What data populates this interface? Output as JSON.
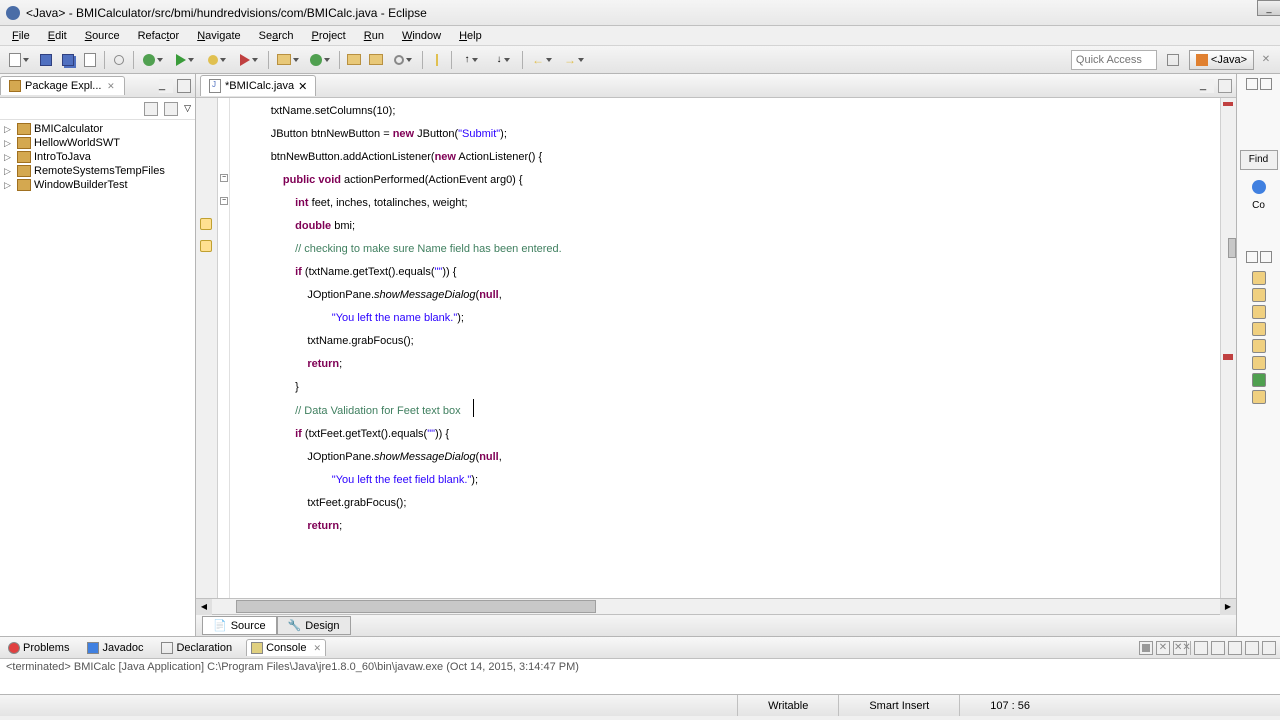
{
  "titlebar": {
    "title": "<Java> - BMICalculator/src/bmi/hundredvisions/com/BMICalc.java - Eclipse"
  },
  "menubar": {
    "items": [
      "File",
      "Edit",
      "Source",
      "Refactor",
      "Navigate",
      "Search",
      "Project",
      "Run",
      "Window",
      "Help"
    ]
  },
  "toolbar": {
    "quick_access_placeholder": "Quick Access",
    "perspective": "<Java>"
  },
  "pkg_explorer": {
    "title": "Package Expl...",
    "projects": [
      "BMICalculator",
      "HellowWorldSWT",
      "IntroToJava",
      "RemoteSystemsTempFiles",
      "WindowBuilderTest"
    ]
  },
  "editor": {
    "tab_title": "*BMICalc.java",
    "source_tab": "Source",
    "design_tab": "Design",
    "code_lines": [
      {
        "indent": 3,
        "tokens": [
          {
            "t": "txtName.setColumns(10);"
          }
        ]
      },
      {
        "indent": 0,
        "tokens": [
          {
            "t": ""
          }
        ]
      },
      {
        "indent": 3,
        "tokens": [
          {
            "t": "JButton btnNewButton = "
          },
          {
            "t": "new",
            "c": "kw"
          },
          {
            "t": " JButton("
          },
          {
            "t": "\"Submit\"",
            "c": "str"
          },
          {
            "t": ");"
          }
        ]
      },
      {
        "indent": 3,
        "tokens": [
          {
            "t": "btnNewButton.addActionListener("
          },
          {
            "t": "new",
            "c": "kw"
          },
          {
            "t": " ActionListener() {"
          }
        ]
      },
      {
        "indent": 4,
        "tokens": [
          {
            "t": "public",
            "c": "kw"
          },
          {
            "t": " "
          },
          {
            "t": "void",
            "c": "kw"
          },
          {
            "t": " actionPerformed(ActionEvent arg0) {"
          }
        ]
      },
      {
        "indent": 5,
        "tokens": [
          {
            "t": "int",
            "c": "kw"
          },
          {
            "t": " feet, inches, totalinches, weight;"
          }
        ]
      },
      {
        "indent": 5,
        "tokens": [
          {
            "t": "double",
            "c": "kw"
          },
          {
            "t": " bmi;"
          }
        ]
      },
      {
        "indent": 5,
        "tokens": [
          {
            "t": "// checking to make sure Name field has been entered.",
            "c": "cmt"
          }
        ]
      },
      {
        "indent": 5,
        "tokens": [
          {
            "t": "if",
            "c": "kw"
          },
          {
            "t": " (txtName.getText().equals("
          },
          {
            "t": "\"\"",
            "c": "str"
          },
          {
            "t": ")) {"
          }
        ]
      },
      {
        "indent": 6,
        "tokens": [
          {
            "t": "JOptionPane."
          },
          {
            "t": "showMessageDialog",
            "c": "mth"
          },
          {
            "t": "("
          },
          {
            "t": "null",
            "c": "kw"
          },
          {
            "t": ","
          }
        ]
      },
      {
        "indent": 8,
        "tokens": [
          {
            "t": "\"You left the name blank.\"",
            "c": "str"
          },
          {
            "t": ");"
          }
        ]
      },
      {
        "indent": 6,
        "tokens": [
          {
            "t": "txtName.grabFocus();"
          }
        ]
      },
      {
        "indent": 6,
        "tokens": [
          {
            "t": "return",
            "c": "kw"
          },
          {
            "t": ";"
          }
        ]
      },
      {
        "indent": 5,
        "tokens": [
          {
            "t": "}"
          }
        ]
      },
      {
        "indent": 5,
        "tokens": [
          {
            "t": "// Data Validation for Feet text box",
            "c": "cmt"
          }
        ],
        "cursor_after": true
      },
      {
        "indent": 5,
        "tokens": [
          {
            "t": "if",
            "c": "kw"
          },
          {
            "t": " (txtFeet.getText().equals("
          },
          {
            "t": "\"\"",
            "c": "str"
          },
          {
            "t": ")) {"
          }
        ]
      },
      {
        "indent": 6,
        "tokens": [
          {
            "t": "JOptionPane."
          },
          {
            "t": "showMessageDialog",
            "c": "mth"
          },
          {
            "t": "("
          },
          {
            "t": "null",
            "c": "kw"
          },
          {
            "t": ","
          }
        ]
      },
      {
        "indent": 8,
        "tokens": [
          {
            "t": "\"You left the feet field blank.\"",
            "c": "str"
          },
          {
            "t": ");"
          }
        ]
      },
      {
        "indent": 6,
        "tokens": [
          {
            "t": "txtFeet.grabFocus();"
          }
        ]
      },
      {
        "indent": 6,
        "tokens": [
          {
            "t": "return",
            "c": "kw"
          },
          {
            "t": ";"
          }
        ]
      }
    ]
  },
  "right": {
    "find": "Find",
    "console_label": "Co"
  },
  "bottom": {
    "tabs": [
      "Problems",
      "Javadoc",
      "Declaration",
      "Console"
    ],
    "console_text": "<terminated> BMICalc [Java Application] C:\\Program Files\\Java\\jre1.8.0_60\\bin\\javaw.exe (Oct 14, 2015, 3:14:47 PM)"
  },
  "statusbar": {
    "writable": "Writable",
    "insert": "Smart Insert",
    "position": "107 : 56"
  }
}
